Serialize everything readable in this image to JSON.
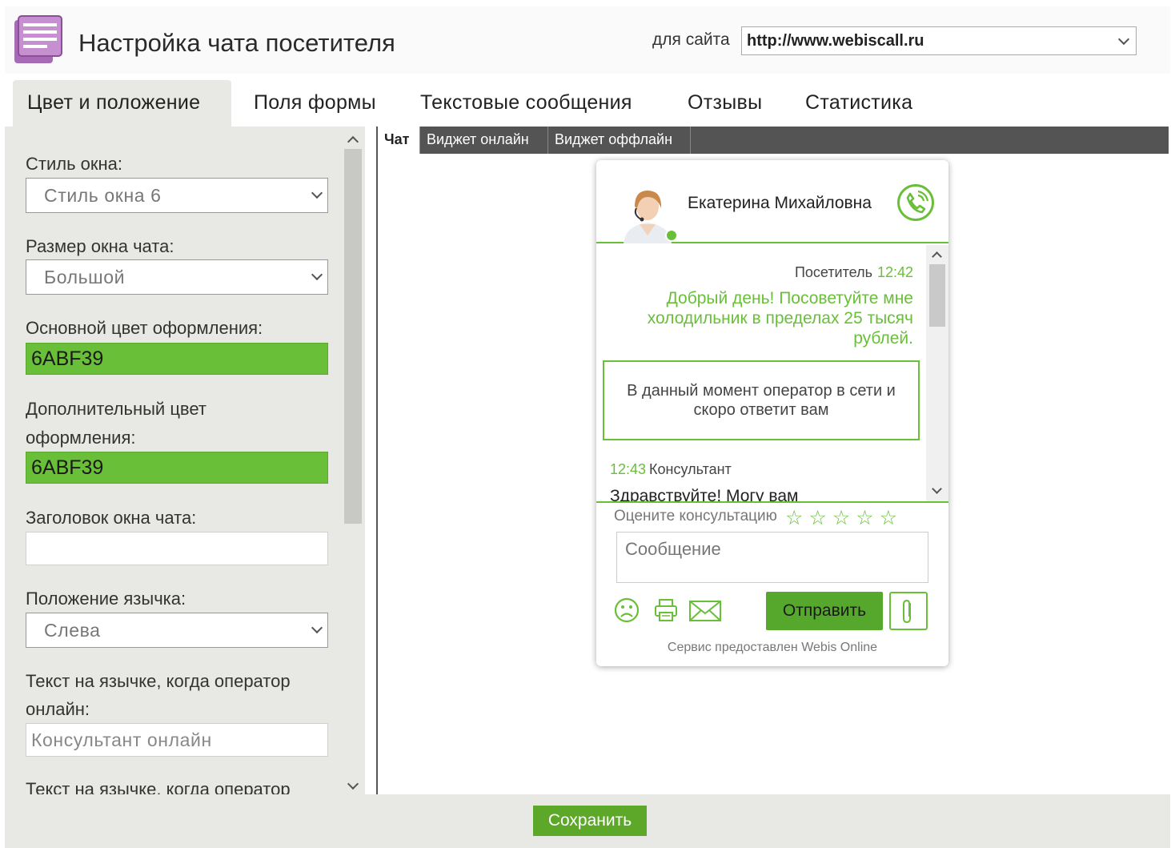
{
  "header": {
    "title": "Настройка чата посетителя",
    "site_label": "для сайта",
    "site_value": "http://www.webiscall.ru"
  },
  "tabs": [
    {
      "label": "Цвет и положение",
      "active": true
    },
    {
      "label": "Поля формы",
      "active": false
    },
    {
      "label": "Текстовые сообщения",
      "active": false
    },
    {
      "label": "Отзывы",
      "active": false
    },
    {
      "label": "Статистика",
      "active": false
    }
  ],
  "settings": {
    "window_style_label": "Стиль окна:",
    "window_style_value": "Стиль окна 6",
    "size_label": "Размер окна чата:",
    "size_value": "Большой",
    "main_color_label": "Основной цвет оформления:",
    "main_color_value": "6ABF39",
    "extra_color_label_1": "Дополнительный цвет",
    "extra_color_label_2": "оформления:",
    "extra_color_value": "6ABF39",
    "chat_title_label": "Заголовок окна чата:",
    "chat_title_value": "",
    "tab_position_label": "Положение язычка:",
    "tab_position_value": "Слева",
    "online_text_label_1": "Текст на язычке, когда оператор",
    "online_text_label_2": "онлайн:",
    "online_text_value": "Консультант онлайн",
    "offline_text_label": "Текст на язычке, когда оператор"
  },
  "preview_tabs": [
    {
      "label": "Чат",
      "active": true
    },
    {
      "label": "Виджет онлайн",
      "active": false
    },
    {
      "label": "Виджет оффлайн",
      "active": false
    }
  ],
  "widget": {
    "operator_name": "Екатерина Михайловна",
    "visitor_label": "Посетитель",
    "visitor_time": "12:42",
    "visitor_message": "Добрый день! Посоветуйте мне холодильник в пределах 25 тысяч рублей.",
    "notice": "В данный момент оператор в сети и скоро ответит вам",
    "consultant_time": "12:43",
    "consultant_label": "Консультант",
    "consultant_message": "Здравствуйте! Могу вам",
    "rate_label": "Оцените консультацию",
    "stars": "☆☆☆☆☆",
    "message_placeholder": "Сообщение",
    "send_label": "Отправить",
    "footer": "Сервис предоставлен Webis Online",
    "accent_color": "#6abf39"
  },
  "save_label": "Сохранить"
}
